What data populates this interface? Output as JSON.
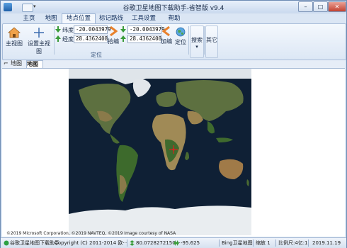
{
  "window": {
    "title": "谷歌卫星地图下载助手-省智版 v9.4",
    "controls": {
      "minimize": "–",
      "maximize": "□",
      "close": "✕"
    }
  },
  "tabs": [
    {
      "label": "主页"
    },
    {
      "label": "地图"
    },
    {
      "label": "地点位置"
    },
    {
      "label": "标记路线"
    },
    {
      "label": "工具设置"
    },
    {
      "label": "帮助"
    }
  ],
  "ribbon": {
    "main_view": "主视图",
    "set_main_view": "设置主视图",
    "lat_label": "纬度:",
    "lon_label": "经度:",
    "lat_value": "-20.0043979",
    "lon_value": "28.4362408",
    "pick": "拾编",
    "lat_value2": "-20.0043979",
    "lon_value2": "28.4362408",
    "edit": "加编",
    "locate": "定位",
    "search": "搜索",
    "other": "其它",
    "group_location": "定位"
  },
  "doc_tabs": [
    {
      "label": "地图"
    },
    {
      "label": "地图"
    }
  ],
  "map": {
    "copyright": "©2019 Microsoft Corporation, ©2019 NAVTEQ, ©2019 Image courtesy of NASA"
  },
  "status": {
    "app": "谷歌卫星地图下载助手",
    "copyright": "Copyright (C) 2011-2014 欧···",
    "lat": "80.0728272150···",
    "lon": "-95.625",
    "source": "Bing卫星地图",
    "zoom": "缩放 1",
    "scale": "比例尺:4亿:1",
    "date": "2019.11.19"
  },
  "colors": {
    "accent": "#dbe6f4",
    "arrow": "#e8812c",
    "ok_arrow": "#3a9b3a"
  }
}
